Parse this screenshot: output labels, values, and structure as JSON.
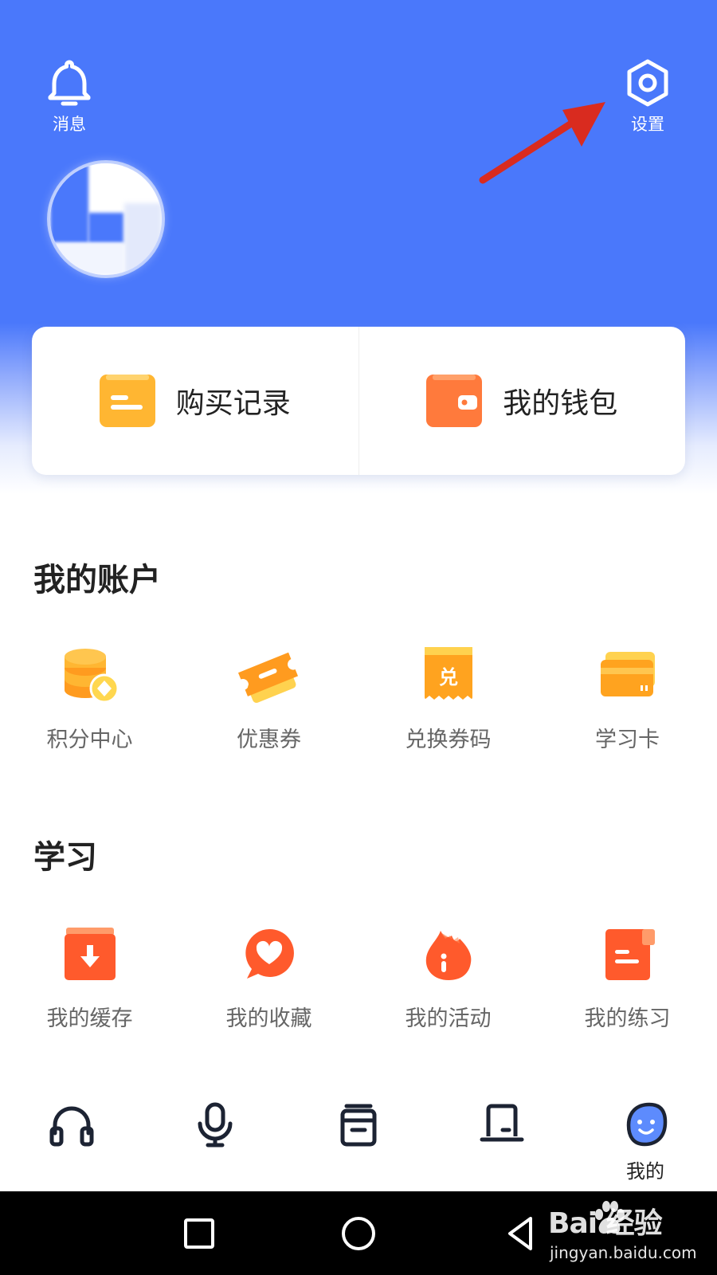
{
  "header": {
    "notify_label": "消息",
    "settings_label": "设置"
  },
  "quick_actions": [
    {
      "label": "购买记录",
      "icon": "receipt-icon"
    },
    {
      "label": "我的钱包",
      "icon": "wallet-icon"
    }
  ],
  "account": {
    "title": "我的账户",
    "items": [
      {
        "label": "积分中心",
        "icon": "coin-stack-icon"
      },
      {
        "label": "优惠券",
        "icon": "ticket-icon"
      },
      {
        "label": "兑换券码",
        "icon": "redeem-code-icon",
        "icon_text": "兑"
      },
      {
        "label": "学习卡",
        "icon": "study-card-icon"
      }
    ]
  },
  "study": {
    "title": "学习",
    "items": [
      {
        "label": "我的缓存",
        "icon": "download-box-icon"
      },
      {
        "label": "我的收藏",
        "icon": "heart-bubble-icon"
      },
      {
        "label": "我的活动",
        "icon": "flame-icon"
      },
      {
        "label": "我的练习",
        "icon": "exercise-doc-icon"
      }
    ]
  },
  "bottom_nav": {
    "items": [
      {
        "icon": "headphones-icon"
      },
      {
        "icon": "microphone-icon"
      },
      {
        "icon": "book-box-icon"
      },
      {
        "icon": "laptop-icon"
      },
      {
        "icon": "smiley-face-icon",
        "label": "我的"
      }
    ]
  },
  "watermark": {
    "brand": "Bai  经验",
    "url": "jingyan.baidu.com"
  },
  "colors": {
    "header_blue": "#4a78fb",
    "icon_yellow": "#ffb632",
    "icon_orange": "#ff7a3c",
    "icon_red_orange": "#ff5a2c",
    "annotation_red": "#d92b1f"
  }
}
